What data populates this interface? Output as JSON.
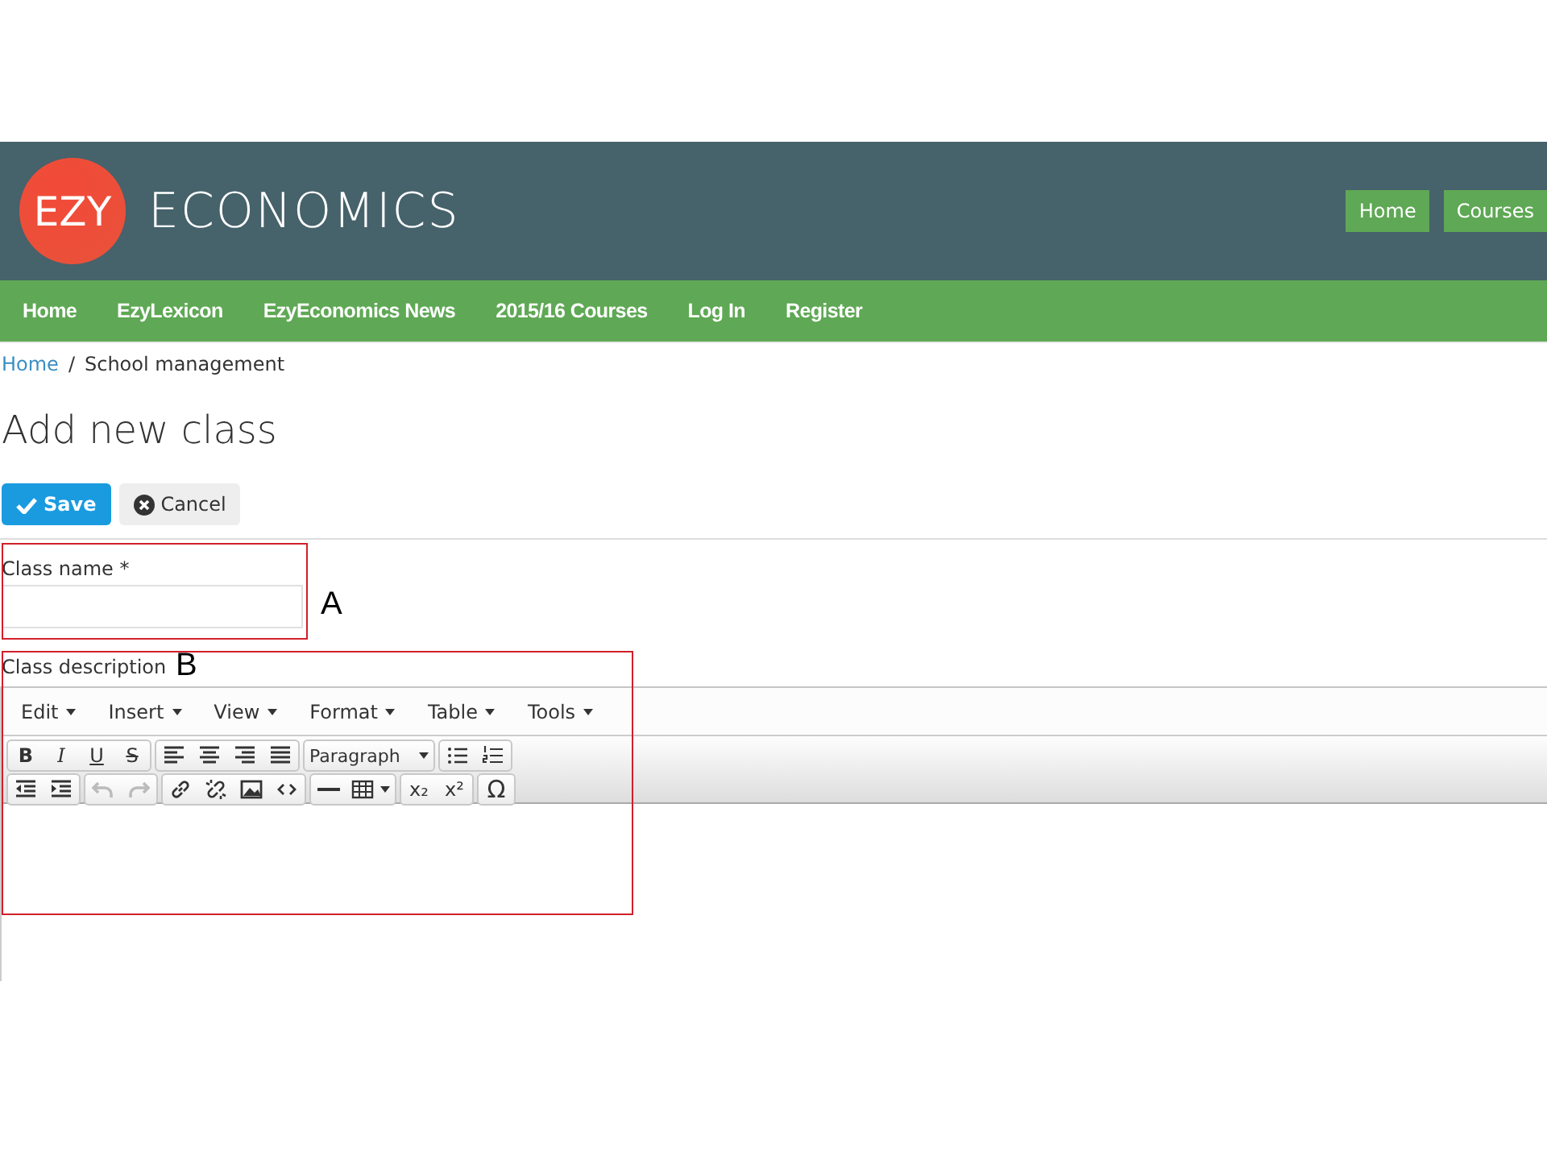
{
  "header": {
    "logo_mark": "EZY",
    "logo_text": "ECONOMICS",
    "buttons": [
      {
        "label": "Home"
      },
      {
        "label": "Courses"
      }
    ]
  },
  "nav": [
    {
      "label": "Home"
    },
    {
      "label": "EzyLexicon"
    },
    {
      "label": "EzyEconomics News"
    },
    {
      "label": "2015/16 Courses"
    },
    {
      "label": "Log In"
    },
    {
      "label": "Register"
    }
  ],
  "breadcrumb": {
    "link": "Home",
    "separator": "/",
    "current": "School management"
  },
  "title": "Add new class",
  "actions": [
    {
      "kind": "primary",
      "label": "Save"
    },
    {
      "kind": "secondary",
      "label": "Cancel"
    }
  ],
  "class_name": {
    "label": "Class name *"
  },
  "description": {
    "label": "Class description",
    "menus": [
      {
        "label": "Edit"
      },
      {
        "label": "Insert"
      },
      {
        "label": "View"
      },
      {
        "label": "Format"
      },
      {
        "label": "Table"
      },
      {
        "label": "Tools"
      }
    ],
    "toolbar_rows": [
      [
        [
          {
            "kind": "bold",
            "text": "B",
            "disabled": false
          },
          {
            "kind": "italic",
            "text": "I",
            "disabled": false
          },
          {
            "kind": "underline",
            "text": "U",
            "disabled": false
          },
          {
            "kind": "strike",
            "text": "S",
            "disabled": false
          }
        ],
        [
          {
            "kind": "align-left",
            "disabled": false
          },
          {
            "kind": "align-center",
            "disabled": false
          },
          {
            "kind": "align-right",
            "disabled": false
          },
          {
            "kind": "justify",
            "disabled": false
          }
        ],
        [
          {
            "kind": "select",
            "text": "Paragraph",
            "disabled": false
          }
        ],
        [
          {
            "kind": "bullets",
            "disabled": false
          },
          {
            "kind": "numbers",
            "disabled": false
          }
        ]
      ],
      [
        [
          {
            "kind": "outdent",
            "disabled": false
          },
          {
            "kind": "indent",
            "disabled": false
          }
        ],
        [
          {
            "kind": "undo",
            "disabled": true
          },
          {
            "kind": "redo",
            "disabled": true
          }
        ],
        [
          {
            "kind": "link",
            "disabled": false
          },
          {
            "kind": "unlink",
            "disabled": false
          },
          {
            "kind": "image",
            "disabled": false
          },
          {
            "kind": "code",
            "disabled": false
          }
        ],
        [
          {
            "kind": "rule",
            "disabled": false
          },
          {
            "kind": "table",
            "disabled": false
          }
        ],
        [
          {
            "kind": "subscript",
            "text": "x₂",
            "disabled": false
          },
          {
            "kind": "superscript",
            "text": "x²",
            "disabled": false
          }
        ],
        [
          {
            "kind": "symbol",
            "text": "Ω",
            "disabled": false
          }
        ]
      ]
    ]
  },
  "annotations": [
    {
      "label": "A"
    },
    {
      "label": "B"
    }
  ]
}
